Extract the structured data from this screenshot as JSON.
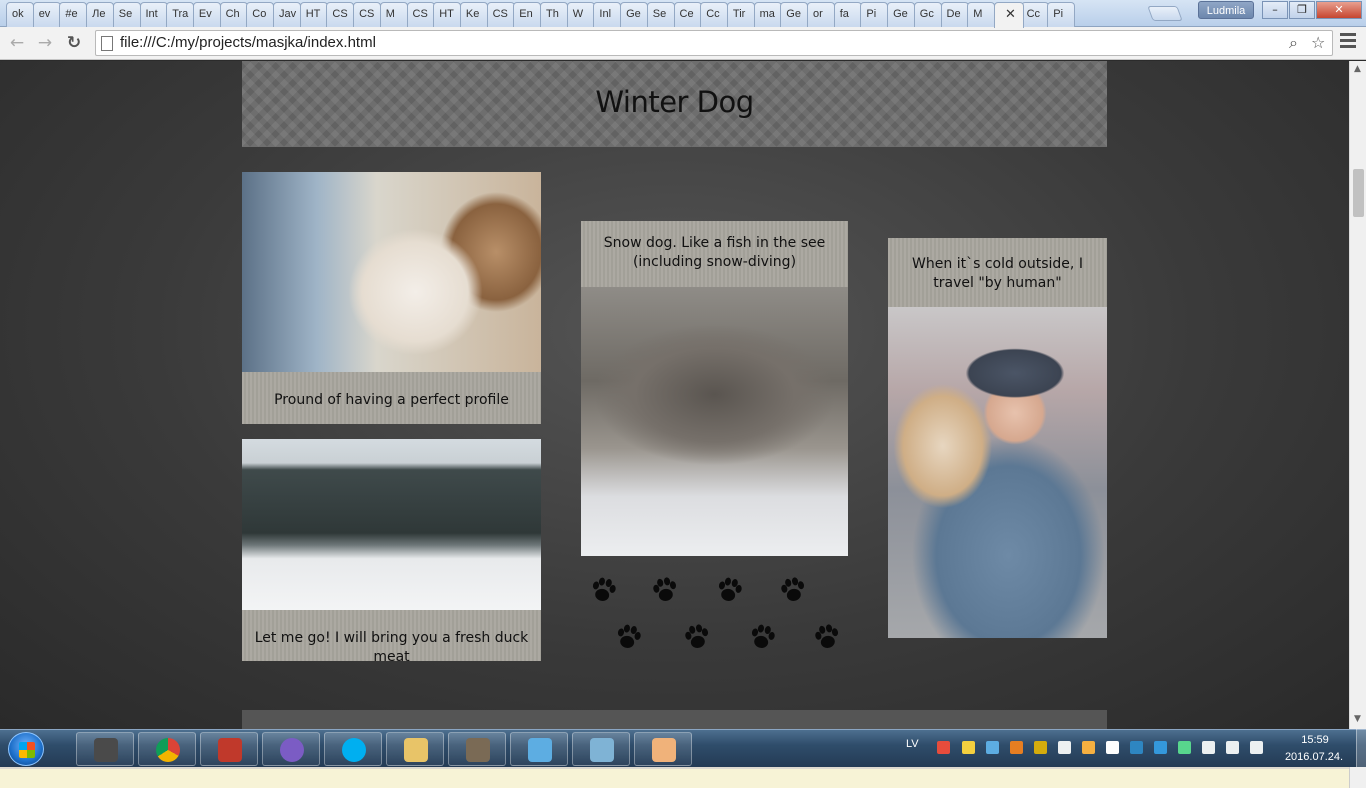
{
  "browser": {
    "tabs": [
      "ok",
      "ev",
      "#e",
      "Ле",
      "Se",
      "Int",
      "Tra",
      "Ev",
      "Ch",
      "Co",
      "Jav",
      "HT",
      "CS",
      "CS",
      "M",
      "CS",
      "HT",
      "Ke",
      "CS",
      "En",
      "Th",
      "W",
      "Inl",
      "Ge",
      "Se",
      "Ce",
      "Cc",
      "Tir",
      "ma",
      "Ge",
      "or",
      "fa",
      "Pi",
      "Ge",
      "Gc",
      "De",
      "M",
      "",
      "Cc",
      "Pi"
    ],
    "active_tab_index": 37,
    "profile_name": "Ludmila",
    "url": "file:///C:/my/projects/masjka/index.html"
  },
  "page": {
    "title": "Winter Dog",
    "cards": [
      {
        "caption": "Pround of having a perfect profile"
      },
      {
        "caption": "Let me go! I will bring you a fresh duck meat"
      },
      {
        "caption": "Snow dog. Like a fish in the see (including snow-diving)"
      },
      {
        "caption": "When it`s cold outside, I travel \"by human\""
      }
    ],
    "paw_icon": "paw-print-icon"
  },
  "taskbar": {
    "language": "LV",
    "time": "15:59",
    "date": "2016.07.24."
  }
}
